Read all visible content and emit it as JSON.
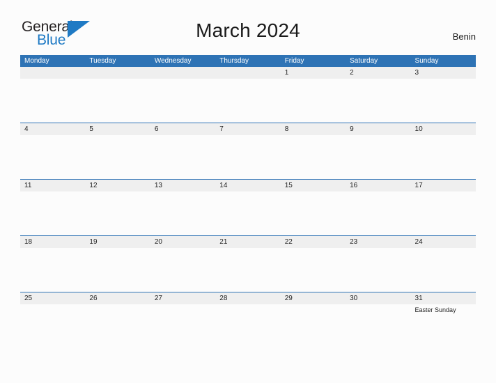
{
  "header": {
    "logo": {
      "text_primary": "General",
      "text_secondary": "Blue",
      "icon": "blue-flag-triangle",
      "color_primary": "#231f20",
      "color_secondary": "#1f7ac4"
    },
    "title": "March 2024",
    "region": "Benin"
  },
  "theme": {
    "header_blue": "#2e73b5",
    "date_band_gray": "#efefef",
    "page_background": "#fcfcfc",
    "text_dark": "#1f1f1f",
    "text_white": "#ffffff"
  },
  "calendar": {
    "month": "March",
    "year": "2024",
    "weekday_headers": [
      "Monday",
      "Tuesday",
      "Wednesday",
      "Thursday",
      "Friday",
      "Saturday",
      "Sunday"
    ],
    "weeks": [
      {
        "days": [
          {
            "date": "",
            "events": []
          },
          {
            "date": "",
            "events": []
          },
          {
            "date": "",
            "events": []
          },
          {
            "date": "",
            "events": []
          },
          {
            "date": "1",
            "events": []
          },
          {
            "date": "2",
            "events": []
          },
          {
            "date": "3",
            "events": []
          }
        ]
      },
      {
        "days": [
          {
            "date": "4",
            "events": []
          },
          {
            "date": "5",
            "events": []
          },
          {
            "date": "6",
            "events": []
          },
          {
            "date": "7",
            "events": []
          },
          {
            "date": "8",
            "events": []
          },
          {
            "date": "9",
            "events": []
          },
          {
            "date": "10",
            "events": []
          }
        ]
      },
      {
        "days": [
          {
            "date": "11",
            "events": []
          },
          {
            "date": "12",
            "events": []
          },
          {
            "date": "13",
            "events": []
          },
          {
            "date": "14",
            "events": []
          },
          {
            "date": "15",
            "events": []
          },
          {
            "date": "16",
            "events": []
          },
          {
            "date": "17",
            "events": []
          }
        ]
      },
      {
        "days": [
          {
            "date": "18",
            "events": []
          },
          {
            "date": "19",
            "events": []
          },
          {
            "date": "20",
            "events": []
          },
          {
            "date": "21",
            "events": []
          },
          {
            "date": "22",
            "events": []
          },
          {
            "date": "23",
            "events": []
          },
          {
            "date": "24",
            "events": []
          }
        ]
      },
      {
        "days": [
          {
            "date": "25",
            "events": []
          },
          {
            "date": "26",
            "events": []
          },
          {
            "date": "27",
            "events": []
          },
          {
            "date": "28",
            "events": []
          },
          {
            "date": "29",
            "events": []
          },
          {
            "date": "30",
            "events": []
          },
          {
            "date": "31",
            "events": [
              "Easter Sunday"
            ]
          }
        ]
      }
    ]
  }
}
